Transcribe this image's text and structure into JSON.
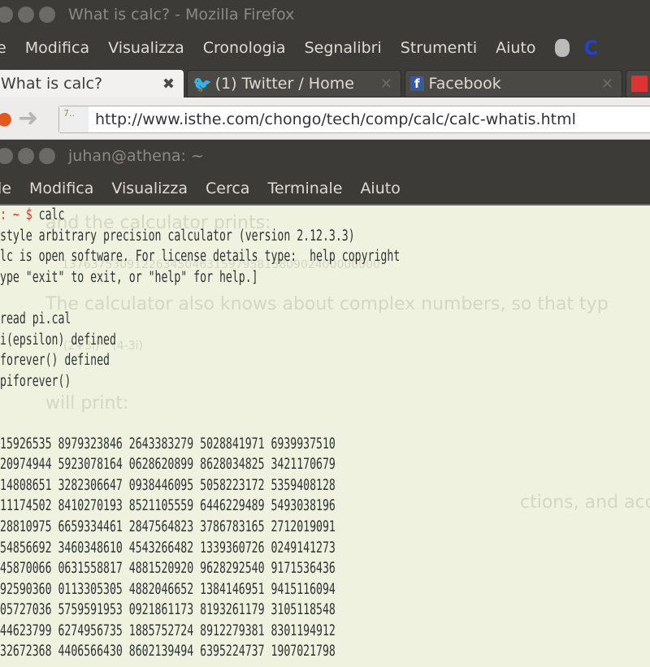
{
  "firefox": {
    "title": "What is calc? - Mozilla Firefox",
    "menu": [
      "e",
      "Modifica",
      "Visualizza",
      "Cronologia",
      "Segnalibri",
      "Strumenti",
      "Aiuto"
    ],
    "tabs": [
      {
        "label": "What is calc?",
        "active": true
      },
      {
        "label": "(1) Twitter / Home"
      },
      {
        "label": "Facebook"
      }
    ],
    "url": "http://www.isthe.com/chongo/tech/comp/calc/calc-whatis.html"
  },
  "terminal": {
    "title": "juhan@athena: ~",
    "menu": [
      "le",
      "Modifica",
      "Visualizza",
      "Cerca",
      "Terminale",
      "Aiuto"
    ],
    "prompt": ": ~ $",
    "command": " calc",
    "lines": [
      "style arbitrary precision calculator (version 2.12.3.3)",
      "lc is open software. For license details type:  help copyright",
      "ype \"exit\" to exit, or \"help\" for help.]",
      "",
      "read pi.cal",
      "i(epsilon) defined",
      "forever() defined",
      "piforever()",
      "",
      "",
      "15926535 8979323846 2643383279 5028841971 6939937510",
      "20974944 5923078164 0628620899 8628034825 3421170679",
      "14808651 3282306647 0938446095 5058223172 5359408128",
      "11174502 8410270193 8521105559 6446229489 5493038196",
      "28810975 6659334461 2847564823 3786783165 2712019091",
      "54856692 3460348610 4543266482 1339360726 0249141273",
      "45870066 0631558817 4881520920 9628292540 9171536436",
      "92590360 0113305305 4882046652 1384146951 9415116094",
      "05727036 5759591953 0921861173 8193261179 3105118548",
      "44623799 6274956735 1885752724 8912279381 8301194912",
      "32672368 4406566430 8602139494 6395224737 1907021798"
    ]
  },
  "background_page": {
    "text1": "and the calculator prints:",
    "num": "13763753091226345046315979581580902400000000",
    "text2": "The calculator also knows about complex numbers, so that typ",
    "expr": "(2+3i) * (4-3i)",
    "text3": "will print:",
    "text4": "ctions, and acc"
  }
}
